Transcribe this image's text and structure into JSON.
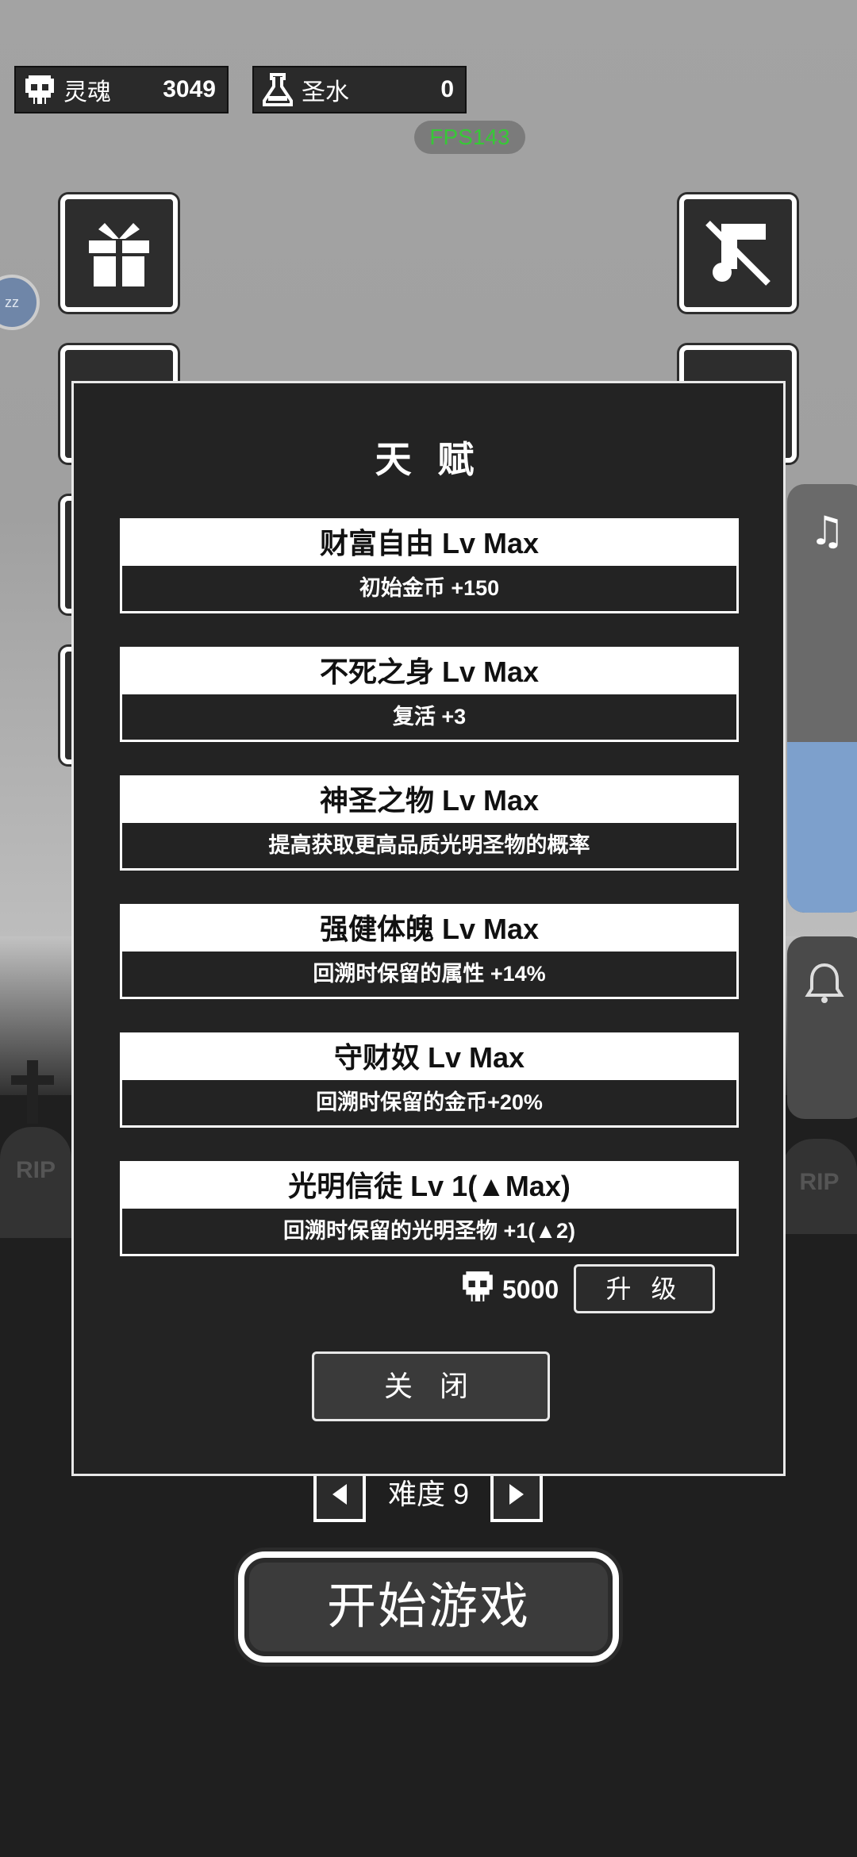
{
  "resources": {
    "souls": {
      "label": "灵魂",
      "value": "3049",
      "icon": "skull-icon"
    },
    "holy_water": {
      "label": "圣水",
      "value": "0",
      "icon": "flask-icon"
    }
  },
  "fps": "FPS143",
  "avatar_text": "zz",
  "tombstones": [
    "RIP",
    "RIP"
  ],
  "modal": {
    "title": "天 赋",
    "talents": [
      {
        "name": "财富自由 Lv Max",
        "desc": "初始金币 +150"
      },
      {
        "name": "不死之身 Lv Max",
        "desc": "复活 +3"
      },
      {
        "name": "神圣之物 Lv Max",
        "desc": "提高获取更高品质光明圣物的概率"
      },
      {
        "name": "强健体魄 Lv Max",
        "desc": "回溯时保留的属性 +14%"
      },
      {
        "name": "守财奴 Lv Max",
        "desc": "回溯时保留的金币+20%"
      },
      {
        "name": "光明信徒 Lv 1(▲Max)",
        "desc": "回溯时保留的光明圣物 +1(▲2)"
      }
    ],
    "cost": "5000",
    "upgrade_label": "升 级",
    "close_label": "关 闭"
  },
  "difficulty": "难度 9",
  "start_label": "开始游戏",
  "colors": {
    "panel": "#232323",
    "border": "#e8e8e8",
    "fps_green": "#37c837",
    "sky": "#a3a3a3"
  }
}
